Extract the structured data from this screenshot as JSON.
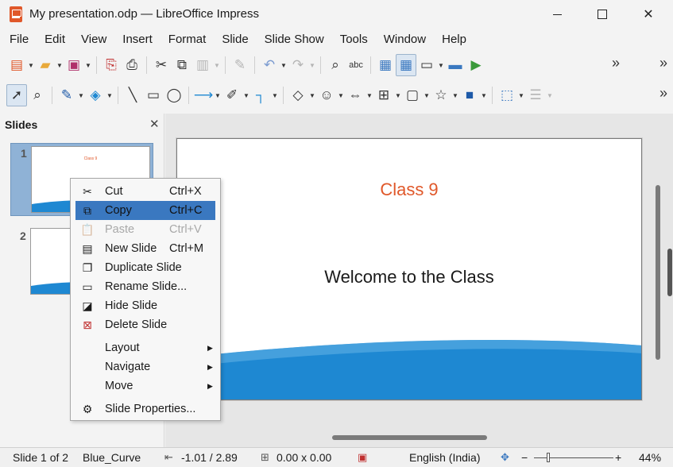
{
  "window": {
    "title": "My presentation.odp — LibreOffice Impress",
    "minimize_glyph": "",
    "maximize_glyph": "",
    "close_glyph": "✕"
  },
  "menubar": [
    "File",
    "Edit",
    "View",
    "Insert",
    "Format",
    "Slide",
    "Slide Show",
    "Tools",
    "Window",
    "Help"
  ],
  "toolbar1": {
    "more_glyph": "»",
    "icons": [
      "new-document-icon",
      "open-folder-icon",
      "save-icon",
      "export-pdf-icon",
      "print-icon",
      "cut-icon",
      "copy-icon",
      "paste-icon",
      "clone-formatting-icon",
      "undo-icon",
      "redo-icon",
      "find-replace-icon",
      "spelling-icon",
      "display-grid-icon",
      "helplines-icon",
      "master-slide-icon",
      "display-views-icon",
      "start-slideshow-icon"
    ]
  },
  "toolbar2": {
    "more_glyph": "»",
    "icons": [
      "select-icon",
      "zoom-pan-icon",
      "line-color-icon",
      "fill-color-icon",
      "insert-line-icon",
      "rectangle-icon",
      "ellipse-icon",
      "arrow-line-icon",
      "curve-icon",
      "connector-icon",
      "basic-shapes-icon",
      "symbol-shapes-icon",
      "block-arrows-icon",
      "flowchart-icon",
      "callouts-icon",
      "stars-icon",
      "3d-objects-icon",
      "transformations-icon",
      "align-icon"
    ]
  },
  "slides_pane": {
    "title": "Slides",
    "close_glyph": "✕",
    "slides": [
      {
        "number": "1",
        "thumb_title": "Class 9"
      },
      {
        "number": "2",
        "thumb_title": ""
      }
    ]
  },
  "slide": {
    "title": "Class 9",
    "subtitle": "Welcome to the Class"
  },
  "context_menu": {
    "items": [
      {
        "label": "Cut",
        "shortcut": "Ctrl+X",
        "icon": "✂",
        "state": "normal"
      },
      {
        "label": "Copy",
        "shortcut": "Ctrl+C",
        "icon": "⧉",
        "state": "highlighted"
      },
      {
        "label": "Paste",
        "shortcut": "Ctrl+V",
        "icon": "📋",
        "state": "disabled"
      },
      {
        "label": "New Slide",
        "shortcut": "Ctrl+M",
        "icon": "▤",
        "state": "normal"
      },
      {
        "label": "Duplicate Slide",
        "shortcut": "",
        "icon": "❐",
        "state": "normal"
      },
      {
        "label": "Rename Slide...",
        "shortcut": "",
        "icon": "▭",
        "state": "normal"
      },
      {
        "label": "Hide Slide",
        "shortcut": "",
        "icon": "◪",
        "state": "normal"
      },
      {
        "label": "Delete Slide",
        "shortcut": "",
        "icon": "⊠",
        "state": "normal"
      },
      {
        "label": "Layout",
        "shortcut": "",
        "icon": "",
        "state": "submenu"
      },
      {
        "label": "Navigate",
        "shortcut": "",
        "icon": "",
        "state": "submenu"
      },
      {
        "label": "Move",
        "shortcut": "",
        "icon": "",
        "state": "submenu"
      },
      {
        "label": "Slide Properties...",
        "shortcut": "",
        "icon": "⚙",
        "state": "normal"
      }
    ]
  },
  "statusbar": {
    "slide_info": "Slide 1 of 2",
    "master": "Blue_Curve",
    "position": "-1.01 / 2.89",
    "size": "0.00 x 0.00",
    "language": "English (India)",
    "zoom_minus": "−",
    "zoom_plus": "+",
    "zoom": "44%"
  },
  "colors": {
    "accent_orange": "#e0582a",
    "wave_blue": "#1e88d2",
    "highlight": "#3a78c0"
  }
}
